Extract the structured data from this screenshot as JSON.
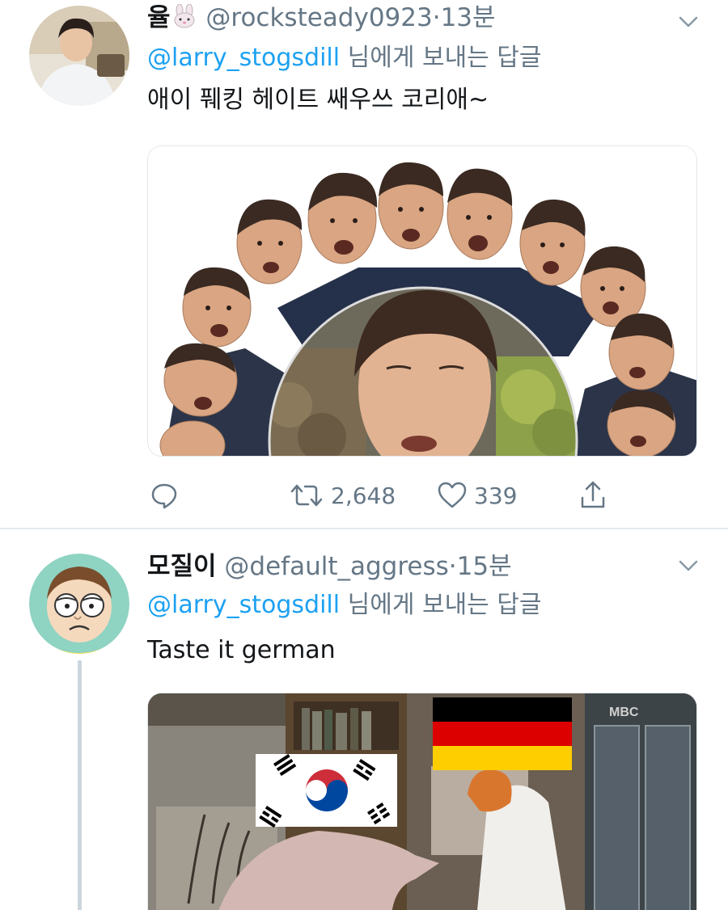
{
  "tweets": [
    {
      "name": "율",
      "name_emoji": "rabbit-face-icon",
      "handle": "@rocksteady0923",
      "dot": "·",
      "time": "13분",
      "reply_to_handle": "@larry_stogsdill",
      "reply_to_suffix": " 님에게 보내는 답글",
      "text": "애이 풰킹 헤이트 쌔우쓰 코리애~",
      "media": "photo-collage-of-one-man-making-many-faces",
      "retweets": "2,648",
      "likes": "339"
    },
    {
      "name": "모질이",
      "handle": "@default_aggress",
      "dot": "·",
      "time": "15분",
      "reply_to_handle": "@larry_stogsdill",
      "reply_to_suffix": " 님에게 보내는 답글",
      "text": "Taste it german",
      "media": "tv-drama-still-with-flag-overlays",
      "watermark": "MBC"
    }
  ],
  "colors": {
    "link": "#1da1f2",
    "secondary_text": "#657786",
    "divider": "#e6ecf0",
    "flag_black": "#000000",
    "flag_red": "#dd0000",
    "flag_gold": "#ffce00",
    "korea_red": "#cd2e3a",
    "korea_blue": "#0047a0"
  }
}
